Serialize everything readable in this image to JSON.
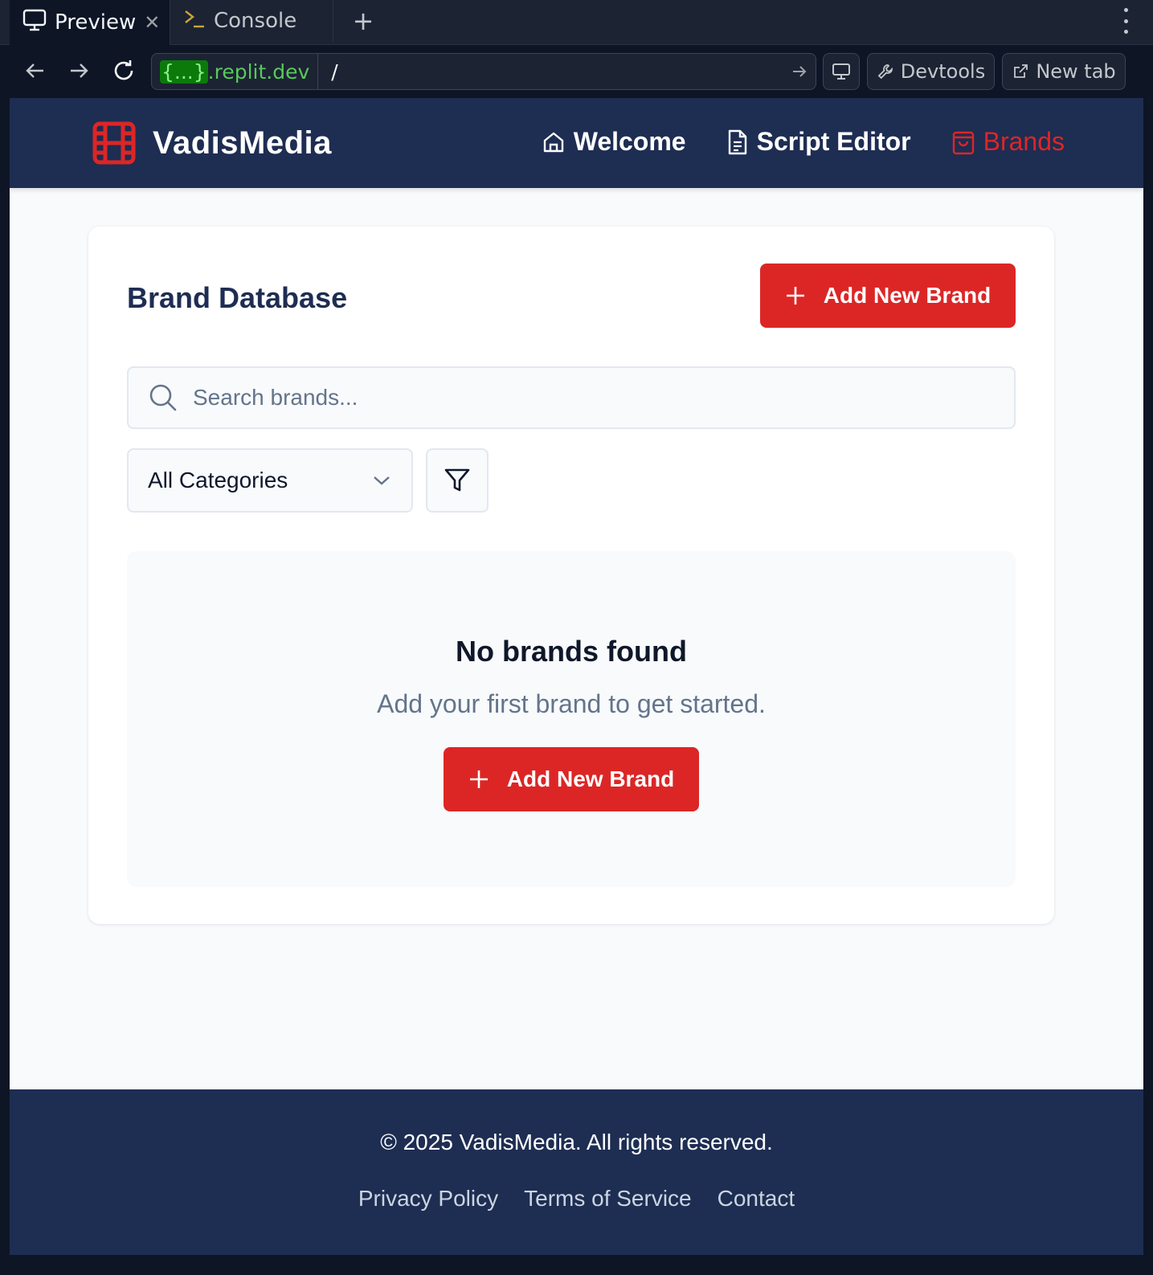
{
  "tabs": {
    "preview_label": "Preview",
    "console_label": "Console",
    "add_label": "+"
  },
  "browser": {
    "url_host_mask": "{...}",
    "url_host": ".replit.dev",
    "url_path": "/",
    "devtools_label": "Devtools",
    "new_tab_label": "New tab"
  },
  "header": {
    "brand": "VadisMedia",
    "nav": [
      {
        "label": "Welcome",
        "icon": "home-icon"
      },
      {
        "label": "Script Editor",
        "icon": "document-icon"
      },
      {
        "label": "Brands",
        "icon": "shopping-bag-icon",
        "active": true
      }
    ]
  },
  "main": {
    "title": "Brand Database",
    "add_button_label": "Add New Brand",
    "search_placeholder": "Search brands...",
    "category_select": "All Categories",
    "empty_title": "No brands found",
    "empty_subtitle": "Add your first brand to get started.",
    "empty_button_label": "Add New Brand"
  },
  "footer": {
    "copyright": "© 2025 VadisMedia. All rights reserved.",
    "links": [
      "Privacy Policy",
      "Terms of Service",
      "Contact"
    ]
  },
  "colors": {
    "accent": "#dc2626",
    "navy": "#1e2d52",
    "chrome_bg": "#0e1525"
  }
}
